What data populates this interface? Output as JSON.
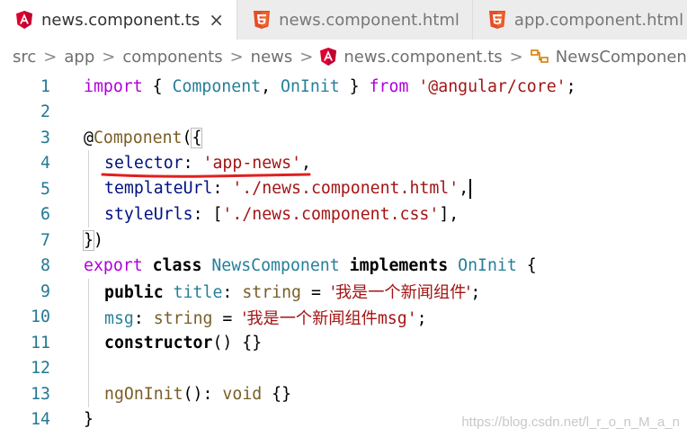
{
  "tabs": [
    {
      "label": "news.component.ts",
      "icon": "angular-icon",
      "active": true,
      "close": "×"
    },
    {
      "label": "news.component.html",
      "icon": "html5-icon",
      "active": false
    },
    {
      "label": "app.component.html",
      "icon": "html5-icon",
      "active": false
    }
  ],
  "breadcrumb": {
    "items": [
      "src",
      "app",
      "components",
      "news",
      "news.component.ts",
      "NewsComponent"
    ],
    "separator": ">"
  },
  "editor": {
    "line_numbers": [
      "1",
      "2",
      "3",
      "4",
      "5",
      "6",
      "7",
      "8",
      "9",
      "10",
      "11",
      "12",
      "13",
      "14"
    ],
    "tokens": {
      "import_kw": "import",
      "open_brace": "{ ",
      "component_name": "Component",
      "comma": ", ",
      "oninit_name": "OnInit",
      "close_brace": " }",
      "from_kw": " from ",
      "module_path": "'@angular/core'",
      "semicolon": ";",
      "at_sign": "@",
      "decorator_name": "Component",
      "paren_open": "(",
      "decorator_brace": "{",
      "selector_key": "selector",
      "colon": ": ",
      "selector_val": "'app-news'",
      "trailing_comma": ",",
      "template_key": "templateUrl",
      "template_val": "'./news.component.html'",
      "style_key": "styleUrls",
      "bracket_open": "[",
      "style_val": "'./news.component.css'",
      "bracket_close": "],",
      "decorator_close_brace": "}",
      "decorator_close_paren": ")",
      "export_kw": "export",
      "class_kw": "class",
      "class_name": "NewsComponent",
      "implements_kw": "implements",
      "implements_name": "OnInit",
      "class_open": " {",
      "public_kw": "public",
      "title_prop": "title",
      "type_colon": ": ",
      "string_type": "string",
      "equals": " = ",
      "title_val": "'我是一个新闻组件'",
      "msg_prop": "msg",
      "msg_val_prefix": "'我是一个新闻组件",
      "msg_val_suffix": "msg'",
      "constructor_kw": "constructor",
      "ctor_sig": "() {}",
      "ngoninit_name": "ngOnInit",
      "call_parens": "()",
      "void_type": "void",
      "empty_body": " {}",
      "class_close": "}"
    }
  },
  "watermark": "https://blog.csdn.net/l_r_o_n_M_a_n",
  "colors": {
    "keyword": "#0000ff",
    "control_keyword": "#af00db",
    "type": "#267f99",
    "string": "#a31515",
    "property": "#001080",
    "function": "#795e26",
    "line_number": "#237893",
    "annotation_underline": "#e02020",
    "angular_red": "#dd0031",
    "html5_orange": "#e44d26"
  }
}
